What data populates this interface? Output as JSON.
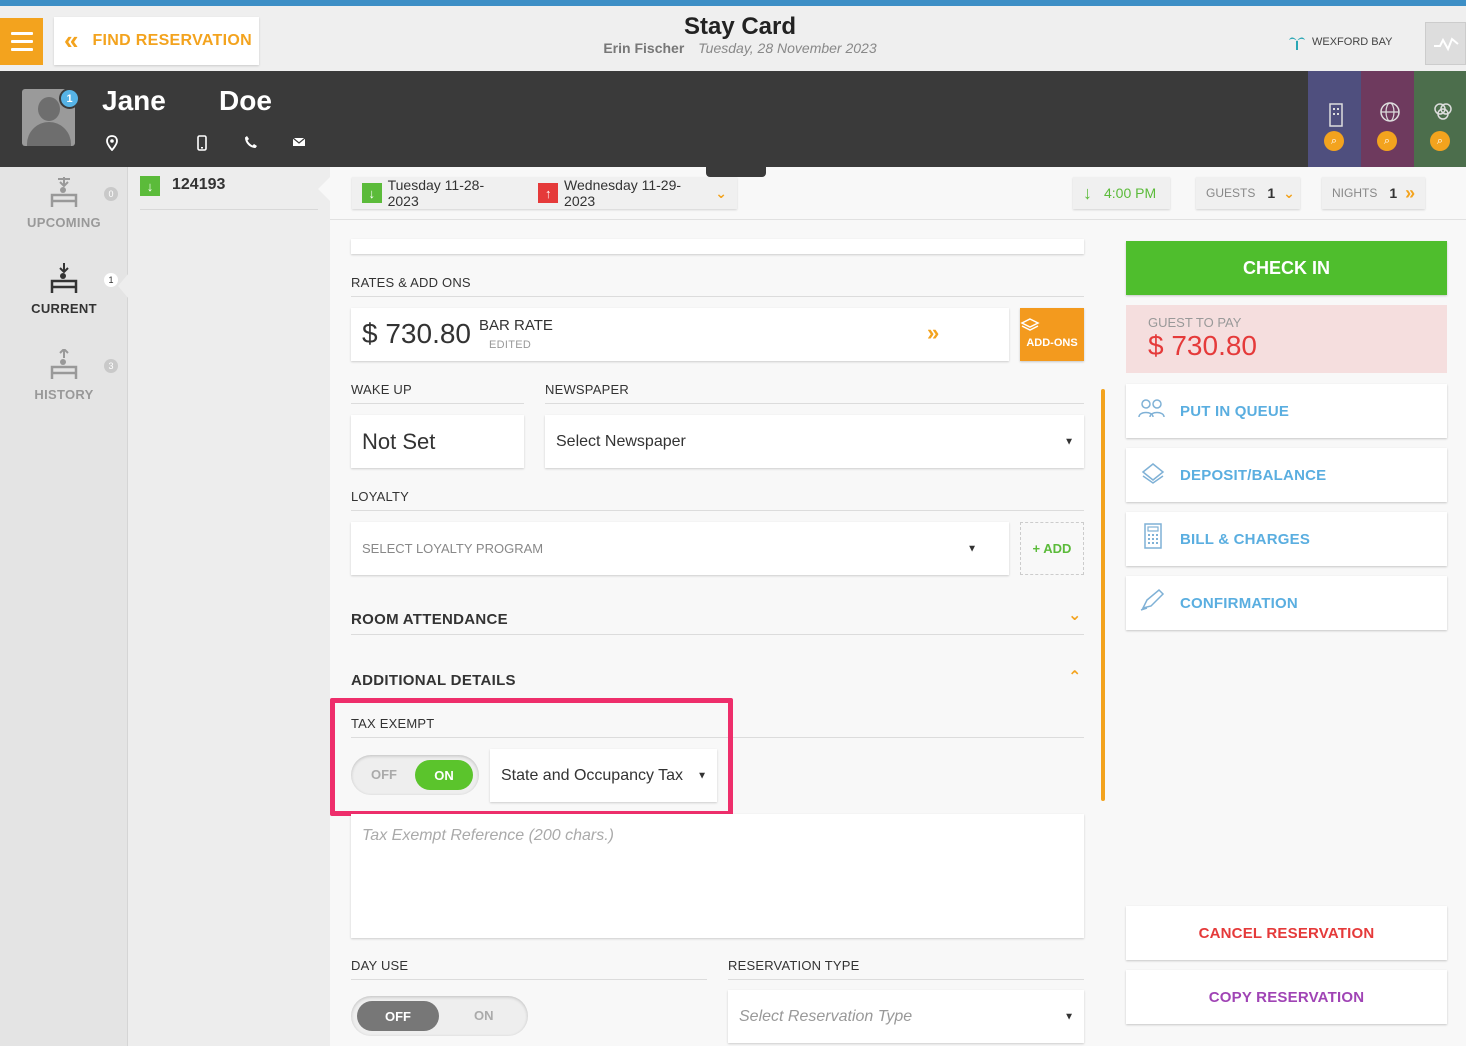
{
  "header": {
    "find_reservation": "FIND RESERVATION",
    "title": "Stay Card",
    "user": "Erin Fischer",
    "date": "Tuesday, 28 November 2023",
    "hotel": "WEXFORD BAY"
  },
  "guest": {
    "first_name": "Jane",
    "last_name": "Doe",
    "avatar_badge": "1"
  },
  "nav": {
    "items": [
      {
        "label": "UPCOMING",
        "count": "0"
      },
      {
        "label": "CURRENT",
        "count": "1"
      },
      {
        "label": "HISTORY",
        "count": "3"
      }
    ]
  },
  "reservation": {
    "number": "124193",
    "arrival": "Tuesday 11-28-2023",
    "departure": "Wednesday 11-29-2023",
    "arrival_time": "4:00 PM",
    "guests_label": "GUESTS",
    "guests": "1",
    "nights_label": "NIGHTS",
    "nights": "1"
  },
  "rates": {
    "section_label": "RATES & ADD ONS",
    "amount": "$ 730.80",
    "rate_name": "BAR RATE",
    "edited": "EDITED",
    "addons_label": "ADD-ONS"
  },
  "wakeup": {
    "label": "WAKE UP",
    "value": "Not Set"
  },
  "newspaper": {
    "label": "NEWSPAPER",
    "value": "Select Newspaper"
  },
  "loyalty": {
    "label": "LOYALTY",
    "placeholder": "SELECT LOYALTY PROGRAM",
    "add": "+ ADD"
  },
  "room_attendance": {
    "label": "ROOM ATTENDANCE"
  },
  "additional_details": {
    "label": "ADDITIONAL DETAILS",
    "tax_exempt_label": "TAX EXEMPT",
    "toggle_off": "OFF",
    "toggle_on": "ON",
    "tax_type": "State and Occupancy Tax",
    "reference_placeholder": "Tax Exempt Reference (200 chars.)"
  },
  "day_use": {
    "label": "DAY USE",
    "off": "OFF",
    "on": "ON"
  },
  "reservation_type": {
    "label": "RESERVATION TYPE",
    "placeholder": "Select Reservation Type"
  },
  "actions": {
    "check_in": "CHECK IN",
    "guest_to_pay_label": "GUEST TO PAY",
    "guest_to_pay": "$ 730.80",
    "put_in_queue": "PUT IN QUEUE",
    "deposit_balance": "DEPOSIT/BALANCE",
    "bill_charges": "BILL & CHARGES",
    "confirmation": "CONFIRMATION",
    "cancel": "CANCEL RESERVATION",
    "copy": "COPY RESERVATION"
  },
  "colors": {
    "accent": "#f3a31e",
    "check_in": "#4fbe2d",
    "danger": "#e53a3a",
    "highlight": "#ee2e6b",
    "link": "#5aaee0",
    "copy": "#a044b5"
  }
}
